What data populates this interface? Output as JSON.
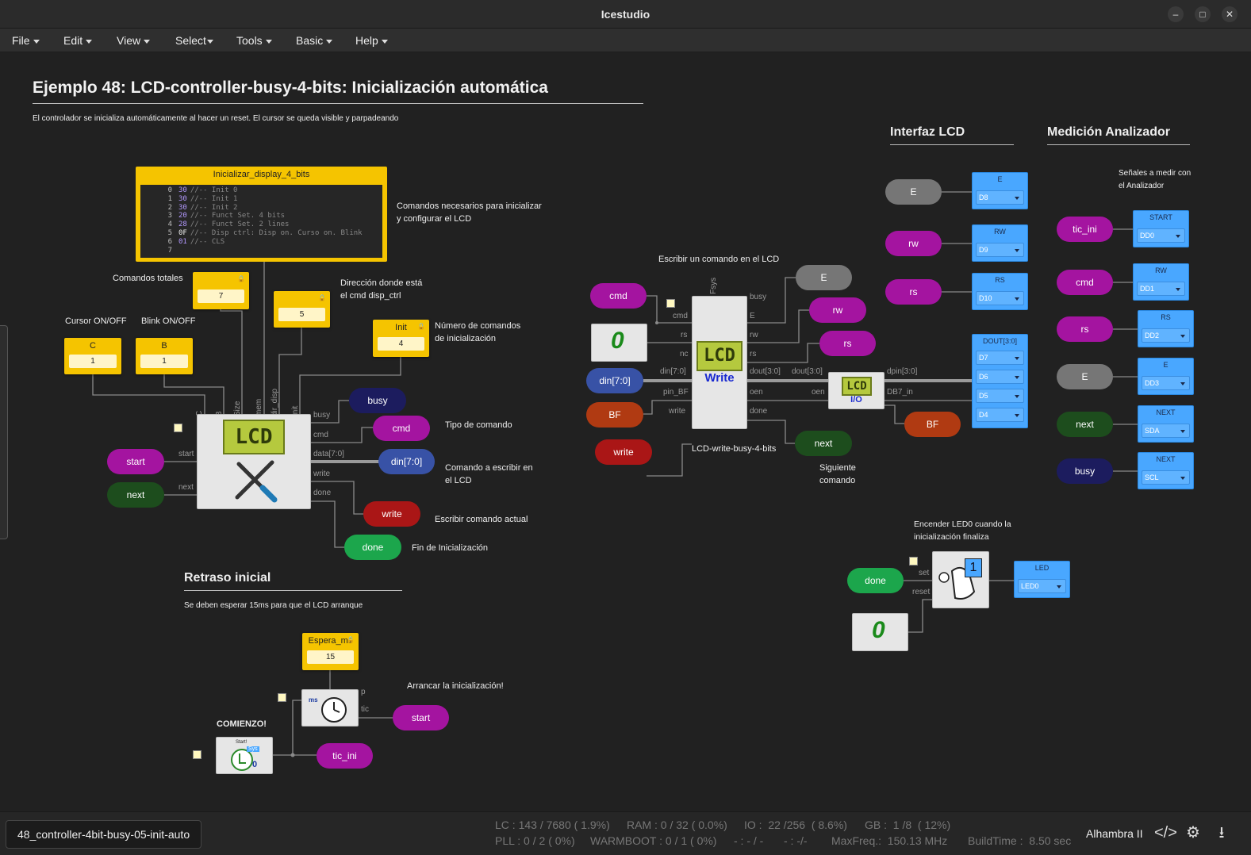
{
  "window": {
    "title": "Icestudio"
  },
  "menu": [
    "File",
    "Edit",
    "View",
    "Select",
    "Tools",
    "Basic",
    "Help"
  ],
  "header": {
    "title": "Ejemplo 48: LCD-controller-busy-4-bits: Inicialización automática",
    "subtitle": "El controlador se inicializa automáticamente al hacer un reset. El cursor se queda visible y parpadeando"
  },
  "memory": {
    "name": "Inicializar_display_4_bits",
    "lines": [
      {
        "n": "0",
        "hex": "30",
        "comment": "//-- Init 0"
      },
      {
        "n": "1",
        "hex": "30",
        "comment": "//-- Init 1"
      },
      {
        "n": "2",
        "hex": "30",
        "comment": "//-- Init 2"
      },
      {
        "n": "3",
        "hex": "20",
        "comment": "//-- Funct Set. 4 bits"
      },
      {
        "n": "4",
        "hex": "28",
        "comment": "//-- Funct Set. 2 lines"
      },
      {
        "n": "5",
        "hex": "0F",
        "comment": "//-- Disp ctrl: Disp on. Curso on. Blink"
      },
      {
        "n": "6",
        "hex": "01",
        "comment": "//-- CLS"
      },
      {
        "n": "7",
        "hex": "",
        "comment": ""
      }
    ],
    "note": "Comandos necesarios para inicializar y configurar el LCD"
  },
  "constants": {
    "total_label": "Comandos totales",
    "total_value": "7",
    "dir_label": "Dirección donde está el cmd disp_ctrl",
    "dir_value": "5",
    "init_name": "Init",
    "init_value": "4",
    "init_label": "Número de comandos de inicialización",
    "c_name": "C",
    "c_value": "1",
    "c_label": "Cursor ON/OFF",
    "b_name": "B",
    "b_value": "1",
    "b_label": "Blink ON/OFF"
  },
  "controller": {
    "inputs": [
      "start",
      "next"
    ],
    "outputs": [
      "busy",
      "cmd",
      "data[7:0]",
      "write",
      "done"
    ],
    "params": [
      "C",
      "B",
      "Size",
      "mem",
      "dir_disp",
      "Init"
    ],
    "labels": {
      "busy": "busy",
      "cmd": "cmd",
      "din": "din[7:0]",
      "write": "write",
      "done": "done",
      "start": "start",
      "next": "next"
    },
    "notes": {
      "cmd": "Tipo de comando",
      "din": "Comando a escribir en el LCD",
      "write": "Escribir comando actual",
      "done": "Fin de Inicialización"
    }
  },
  "delay": {
    "title": "Retraso inicial",
    "subtitle": "Se deben esperar 15ms para que el LCD arranque",
    "const_name": "Espera_ms",
    "const_value": "15",
    "note": "Arrancar la inicialización!",
    "comienzo": "COMIENZO!",
    "start_label": "start",
    "tic_label": "tic_ini",
    "timer_ports": [
      "p",
      "tic"
    ],
    "timer_unit": "ms",
    "start_icon_text": "Start!",
    "sys_text": "Sys",
    "zero": "0"
  },
  "lcd_write": {
    "note": "Escribir un comando en el LCD",
    "name": "LCD-write-busy-4-bits",
    "title": "Write",
    "lcd_text": "LCD",
    "inputs": [
      "cmd",
      "din[7:0]",
      "BF",
      "write"
    ],
    "in_ports": [
      "Fsys",
      "cmd",
      "rs",
      "nc",
      "din[7:0]",
      "pin_BF",
      "write"
    ],
    "out_ports": [
      "busy",
      "E",
      "rw",
      "rs",
      "dout[3:0]",
      "oen",
      "done"
    ],
    "outputs": {
      "E": "E",
      "rw": "rw",
      "rs": "rs",
      "next": "next"
    },
    "next_note": "Siguiente comando",
    "zero": "0"
  },
  "io_block": {
    "title": "I/O",
    "lcd_text": "LCD",
    "ports": [
      "dout[3:0]",
      "oen",
      "dpin[3:0]",
      "DB7_in"
    ],
    "bf": "BF"
  },
  "lcd_interface": {
    "title": "Interfaz LCD",
    "labels": [
      "E",
      "rw",
      "rs"
    ],
    "pins": [
      {
        "name": "E",
        "value": "D8"
      },
      {
        "name": "RW",
        "value": "D9"
      },
      {
        "name": "RS",
        "value": "D10"
      }
    ],
    "dout": {
      "name": "DOUT[3:0]",
      "values": [
        "D7",
        "D6",
        "D5",
        "D4"
      ]
    }
  },
  "analyzer": {
    "title": "Medición Analizador",
    "note": "Señales a medir con el Analizador",
    "rows": [
      {
        "signal": "tic_ini",
        "name": "START",
        "value": "DD0"
      },
      {
        "signal": "cmd",
        "name": "RW",
        "value": "DD1"
      },
      {
        "signal": "rs",
        "name": "RS",
        "value": "DD2"
      },
      {
        "signal": "E",
        "name": "E",
        "value": "DD3"
      },
      {
        "signal": "next",
        "name": "NEXT",
        "value": "SDA"
      },
      {
        "signal": "busy",
        "name": "NEXT",
        "value": "SCL"
      }
    ]
  },
  "led": {
    "note": "Encender LED0 cuando la inicialización finaliza",
    "input": "done",
    "ports": [
      "set",
      "reset"
    ],
    "pin_name": "LED",
    "pin_value": "LED0",
    "zero": "0",
    "one": "1"
  },
  "status": {
    "file": "48_controller-4bit-busy-05-init-auto",
    "lc": "LC : 143 / 7680 ( 1.9%)",
    "ram": "RAM : 0 / 32 ( 0.0%)",
    "io": "IO :  22 /256  ( 8.6%)",
    "gb": "GB :  1 /8  ( 12%)",
    "pll": "PLL : 0 / 2 ( 0%)",
    "warmboot": "WARMBOOT : 0 / 1 ( 0%)",
    "dash1": "- : - / -",
    "dash2": "- : -/-",
    "maxfreq": "MaxFreq.:  150.13 MHz",
    "buildtime": "BuildTime :  8.50 sec",
    "board": "Alhambra II"
  },
  "colors": {
    "const_yellow": "#f5c400",
    "pin_blue": "#49a7ff",
    "magenta": "#a414a0",
    "wire": "#8a8a8a",
    "canvas": "#212121"
  }
}
